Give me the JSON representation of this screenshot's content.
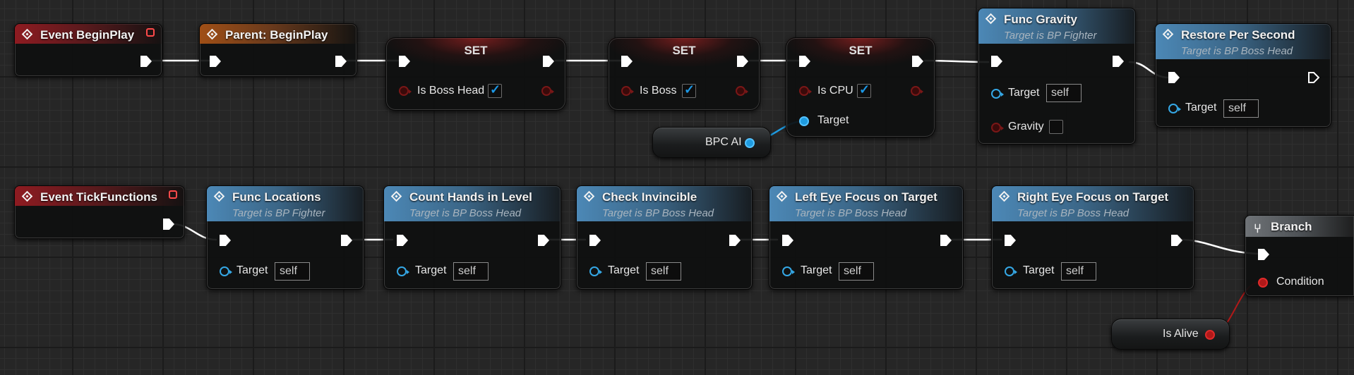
{
  "colors": {
    "exec_wire": "#ffffff",
    "object_pin": "#1f9be0",
    "bool_pin": "#b01919",
    "event_header": "#8e1b21",
    "parent_header": "#a04f16",
    "function_header": "#4c88b6",
    "branch_header": "#6f7377"
  },
  "icons": {
    "event": "event-diamond-icon",
    "function": "function-icon",
    "branch": "branch-icon",
    "delegate": "delegate-square-icon",
    "exec": "exec-arrow-icon"
  },
  "nodes": {
    "event_beginplay": {
      "title": "Event BeginPlay"
    },
    "parent_beginplay": {
      "title": "Parent: BeginPlay"
    },
    "set1": {
      "title": "SET",
      "var_label": "Is Boss Head",
      "checked": true
    },
    "set2": {
      "title": "SET",
      "var_label": "Is Boss",
      "checked": true
    },
    "set3": {
      "title": "SET",
      "var_label": "Is CPU",
      "checked": true,
      "target_label": "Target"
    },
    "bpc_ai": {
      "label": "BPC AI"
    },
    "func_gravity": {
      "title": "Func Gravity",
      "subtitle": "Target is BP Fighter",
      "target_label": "Target",
      "self_value": "self",
      "gravity_label": "Gravity",
      "gravity_checked": false
    },
    "restore_per_second": {
      "title": "Restore Per Second",
      "subtitle": "Target is BP Boss Head",
      "target_label": "Target",
      "self_value": "self"
    },
    "event_tickfunctions": {
      "title": "Event TickFunctions"
    },
    "func_locations": {
      "title": "Func Locations",
      "subtitle": "Target is BP Fighter",
      "target_label": "Target",
      "self_value": "self"
    },
    "count_hands": {
      "title": "Count Hands in Level",
      "subtitle": "Target is BP Boss Head",
      "target_label": "Target",
      "self_value": "self"
    },
    "check_invincible": {
      "title": "Check Invincible",
      "subtitle": "Target is BP Boss Head",
      "target_label": "Target",
      "self_value": "self"
    },
    "left_eye": {
      "title": "Left Eye Focus on Target",
      "subtitle": "Target is BP Boss Head",
      "target_label": "Target",
      "self_value": "self"
    },
    "right_eye": {
      "title": "Right Eye Focus on Target",
      "subtitle": "Target is BP Boss Head",
      "target_label": "Target",
      "self_value": "self"
    },
    "branch": {
      "title": "Branch",
      "condition_label": "Condition"
    },
    "is_alive": {
      "label": "Is Alive"
    }
  }
}
